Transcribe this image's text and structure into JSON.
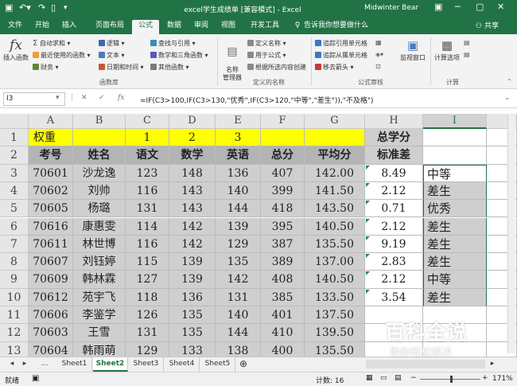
{
  "titlebar": {
    "title": "excel学生成绩单 [兼容模式] - Excel",
    "user": "Midwinter Bear",
    "save_icon": "save-icon",
    "undo_icon": "undo-icon",
    "redo_icon": "redo-icon"
  },
  "tabs": [
    "文件",
    "开始",
    "插入",
    "页面布局",
    "公式",
    "数据",
    "审阅",
    "视图",
    "开发工具"
  ],
  "active_tab": "公式",
  "search_placeholder": "告诉我你想要做什么",
  "share_label": "共享",
  "ribbon": {
    "insert_function": "插入函数",
    "autosum": "自动求和",
    "recent": "最近使用的函数",
    "financial": "财务",
    "logical": "逻辑",
    "text": "文本",
    "datetime": "日期和时间",
    "lookup": "查找与引用",
    "math": "数学和三角函数",
    "more": "其他函数",
    "group_library": "函数库",
    "name_manager": "名称\n管理器",
    "define_name": "定义名称",
    "use_in_formula": "用于公式",
    "create_from_selection": "根据所选内容创建",
    "group_names": "定义的名称",
    "trace_precedents": "追踪引用单元格",
    "trace_dependents": "追踪从属单元格",
    "remove_arrows": "移去箭头",
    "watch_window": "监视窗口",
    "group_audit": "公式审核",
    "calc_options": "计算选项",
    "group_calc": "计算"
  },
  "formula_bar": {
    "name_box": "I3",
    "formula": "=IF(C3>100,IF(C3>130,\"优秀\",IF(C3>120,\"中等\",\"差生\")),\"不及格\")"
  },
  "columns": [
    "A",
    "B",
    "C",
    "D",
    "E",
    "F",
    "G",
    "H",
    "I"
  ],
  "selected_column": "I",
  "rows": [
    [
      "权重",
      "",
      "1",
      "2",
      "3",
      "",
      "",
      "总学分",
      ""
    ],
    [
      "考号",
      "姓名",
      "语文",
      "数学",
      "英语",
      "总分",
      "平均分",
      "标准差",
      ""
    ],
    [
      "70601",
      "沙龙逸",
      "123",
      "148",
      "136",
      "407",
      "142.00",
      "8.49",
      "中等"
    ],
    [
      "70602",
      "刘帅",
      "116",
      "143",
      "140",
      "399",
      "141.50",
      "2.12",
      "差生"
    ],
    [
      "70605",
      "杨璐",
      "131",
      "143",
      "144",
      "418",
      "143.50",
      "0.71",
      "优秀"
    ],
    [
      "70616",
      "康惠雯",
      "114",
      "142",
      "139",
      "395",
      "140.50",
      "2.12",
      "差生"
    ],
    [
      "70611",
      "林世博",
      "116",
      "142",
      "129",
      "387",
      "135.50",
      "9.19",
      "差生"
    ],
    [
      "70607",
      "刘钰婷",
      "115",
      "139",
      "135",
      "389",
      "137.00",
      "2.83",
      "差生"
    ],
    [
      "70609",
      "韩林霖",
      "127",
      "139",
      "142",
      "408",
      "140.50",
      "2.12",
      "中等"
    ],
    [
      "70612",
      "苑宇飞",
      "118",
      "136",
      "131",
      "385",
      "133.50",
      "3.54",
      "差生"
    ],
    [
      "70606",
      "李鉴学",
      "126",
      "135",
      "140",
      "401",
      "137.50",
      "",
      ""
    ],
    [
      "70603",
      "王雪",
      "131",
      "135",
      "144",
      "410",
      "139.50",
      "",
      ""
    ],
    [
      "70604",
      "韩雨萌",
      "129",
      "133",
      "138",
      "400",
      "135.50",
      "",
      ""
    ]
  ],
  "sheets": [
    "Sheet1",
    "Sheet2",
    "Sheet3",
    "Sheet4",
    "Sheet5"
  ],
  "active_sheet": "Sheet2",
  "status": {
    "ready": "就绪",
    "count_label": "计数: 16",
    "zoom": "171%"
  },
  "watermark": {
    "brand": "百科全说",
    "slogan": "助你轻松解决"
  },
  "colors": {
    "excel_green": "#217346",
    "yellow": "#ffff00",
    "gray_fill": "#cfcfcf",
    "dark_gray_fill": "#b4b4b4"
  }
}
